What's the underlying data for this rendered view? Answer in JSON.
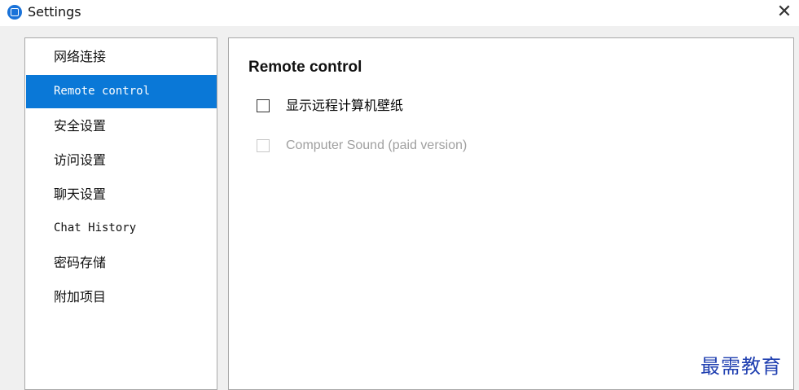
{
  "window": {
    "title": "Settings",
    "close_label": "✕"
  },
  "sidebar": {
    "items": [
      {
        "label": "网络连接",
        "selected": false
      },
      {
        "label": "Remote control",
        "selected": true
      },
      {
        "label": "安全设置",
        "selected": false
      },
      {
        "label": "访问设置",
        "selected": false
      },
      {
        "label": "聊天设置",
        "selected": false
      },
      {
        "label": "Chat History",
        "selected": false
      },
      {
        "label": "密码存储",
        "selected": false
      },
      {
        "label": "附加项目",
        "selected": false
      }
    ]
  },
  "main": {
    "section_title": "Remote control",
    "options": [
      {
        "label": "显示远程计算机壁纸",
        "checked": false,
        "enabled": true
      },
      {
        "label": "Computer Sound (paid version)",
        "checked": false,
        "enabled": false
      }
    ]
  },
  "watermark": "最需教育",
  "colors": {
    "selection": "#0a78d7",
    "app_icon": "#1a73d9",
    "watermark": "#1f3fb0",
    "disabled_text": "#a0a0a0"
  }
}
